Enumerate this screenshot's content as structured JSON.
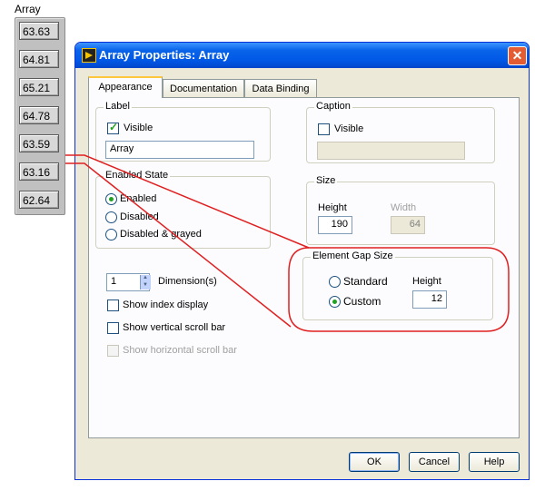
{
  "front_panel": {
    "array_label": "Array",
    "values": [
      "63.63",
      "64.81",
      "65.21",
      "64.78",
      "63.59",
      "63.16",
      "62.64"
    ]
  },
  "dialog": {
    "title": "Array Properties: Array",
    "close_glyph": "✕",
    "tabs": [
      "Appearance",
      "Documentation",
      "Data Binding"
    ],
    "label_group": {
      "title": "Label",
      "visible_label": "Visible",
      "visible_checked": true,
      "value": "Array"
    },
    "caption_group": {
      "title": "Caption",
      "visible_label": "Visible",
      "visible_checked": false,
      "value": ""
    },
    "enabled_state": {
      "title": "Enabled State",
      "options": [
        "Enabled",
        "Disabled",
        "Disabled & grayed"
      ],
      "selected": "Enabled"
    },
    "size_group": {
      "title": "Size",
      "height_label": "Height",
      "height_value": "190",
      "width_label": "Width",
      "width_value": "64"
    },
    "element_gap": {
      "title": "Element Gap Size",
      "options": [
        "Standard",
        "Custom"
      ],
      "selected": "Custom",
      "height_label": "Height",
      "height_value": "12"
    },
    "dimensions": {
      "value": "1",
      "label": "Dimension(s)"
    },
    "checkboxes": {
      "show_index_display": "Show index display",
      "show_vertical_scroll_bar": "Show vertical scroll bar",
      "show_horizontal_scroll_bar": "Show horizontal scroll bar"
    },
    "buttons": {
      "ok": "OK",
      "cancel": "Cancel",
      "help": "Help"
    }
  },
  "colors": {
    "annotation": "#e02020",
    "titlebar": "#0058e6",
    "check": "#21a121"
  }
}
